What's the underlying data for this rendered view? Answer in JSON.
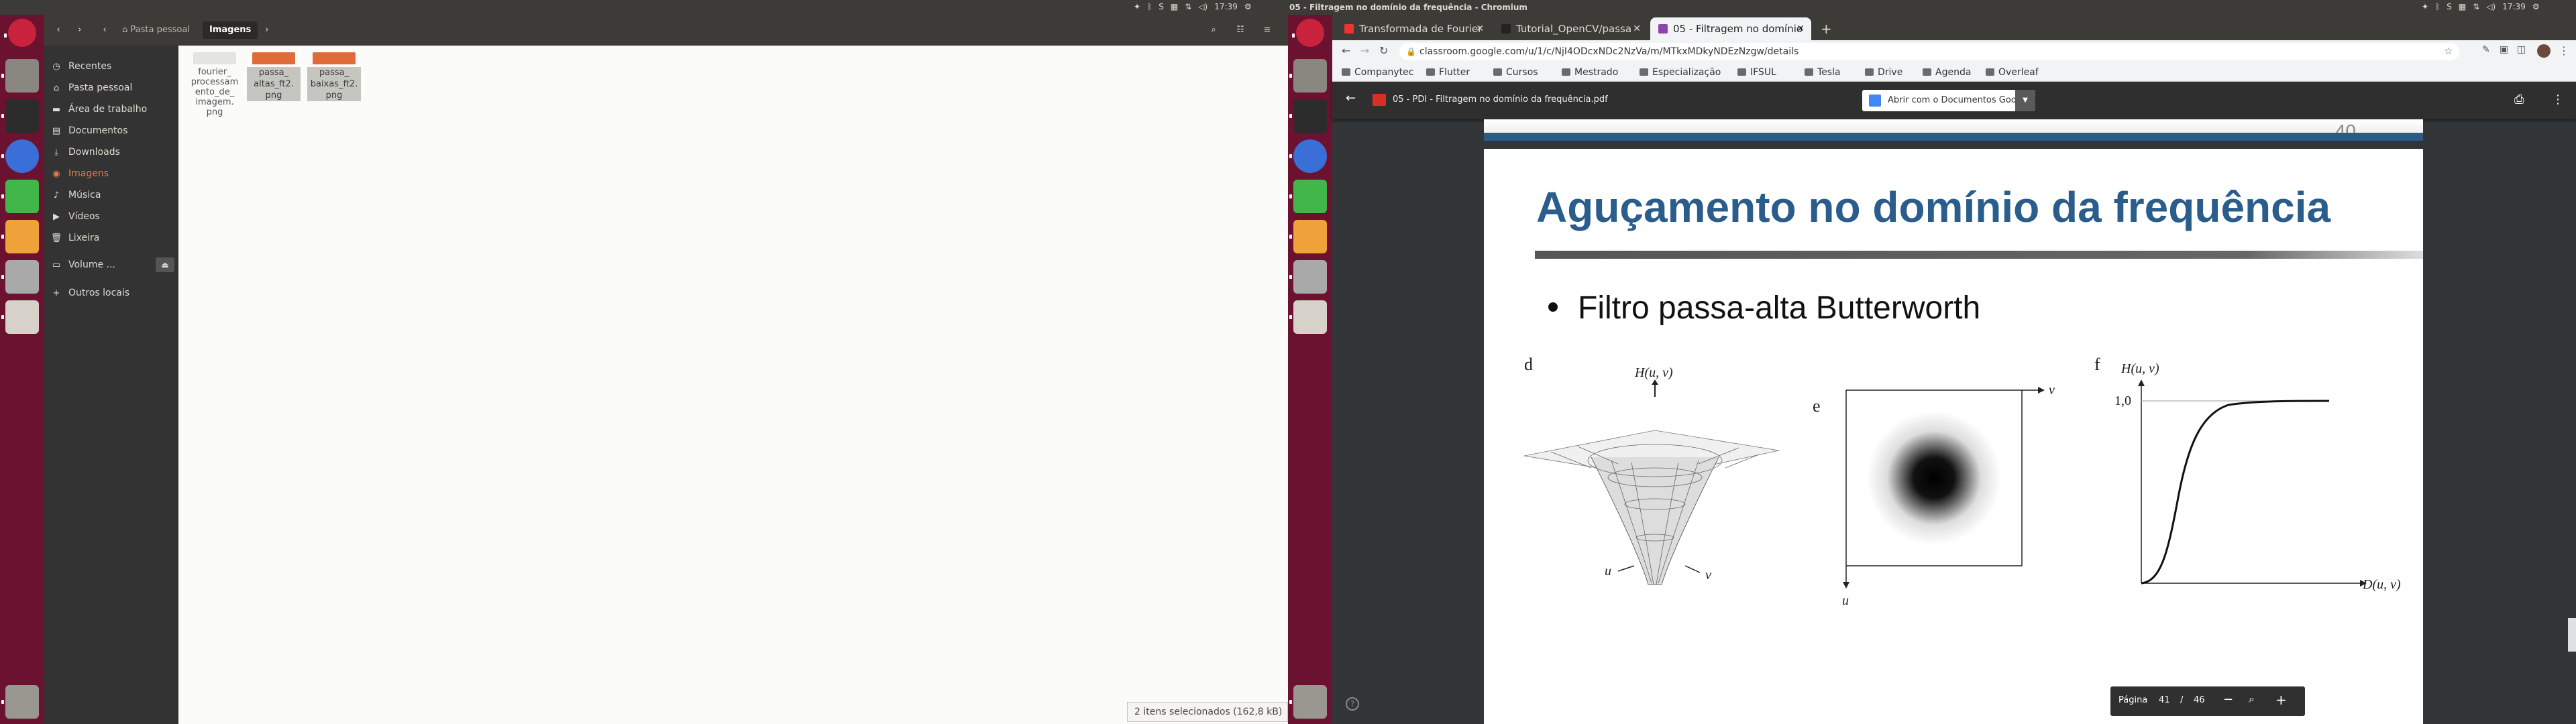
{
  "left_panel": {
    "time": "17:39",
    "tray_icons": [
      "dropbox-icon",
      "bluetooth-icon",
      "skype-icon",
      "keyboard-layout-icon",
      "wifi-icon",
      "volume-icon",
      "settings-icon"
    ]
  },
  "right_panel": {
    "window_title": "05 - Filtragem no domínio da frequência - Chromium",
    "time": "17:39"
  },
  "nautilus": {
    "breadcrumb_home": "Pasta pessoal",
    "breadcrumb_current": "Imagens",
    "sidebar": [
      {
        "label": "Recentes",
        "icon": "clock-icon",
        "glyph": "◷"
      },
      {
        "label": "Pasta pessoal",
        "icon": "home-icon",
        "glyph": "⌂"
      },
      {
        "label": "Área de trabalho",
        "icon": "folder-icon",
        "glyph": "▬"
      },
      {
        "label": "Documentos",
        "icon": "document-icon",
        "glyph": "▤"
      },
      {
        "label": "Downloads",
        "icon": "download-icon",
        "glyph": "⤓"
      },
      {
        "label": "Imagens",
        "icon": "camera-icon",
        "glyph": "◉"
      },
      {
        "label": "Música",
        "icon": "music-icon",
        "glyph": "♪"
      },
      {
        "label": "Vídeos",
        "icon": "video-icon",
        "glyph": "▶"
      },
      {
        "label": "Lixeira",
        "icon": "trash-icon",
        "glyph": "🗑"
      },
      {
        "label": "Volume ...",
        "icon": "drive-icon",
        "glyph": "▭"
      },
      {
        "label": "Outros locais",
        "icon": "plus-icon",
        "glyph": "+"
      }
    ],
    "files": [
      {
        "name": "fourier_processamento_de_imagem.png",
        "lines": [
          "fourier_",
          "processam",
          "ento_de_",
          "imagem.",
          "png"
        ],
        "selected": false,
        "thumb": "#e4e4e0"
      },
      {
        "name": "passa_altas_ft2.png",
        "lines": [
          "passa_",
          "altas_ft2.",
          "png"
        ],
        "selected": true,
        "thumb": "#e06a3a"
      },
      {
        "name": "passa_baixas_ft2.png",
        "lines": [
          "passa_",
          "baixas_ft2.",
          "png"
        ],
        "selected": true,
        "thumb": "#e06a3a"
      }
    ],
    "status": "2 itens selecionados (162,8 kB)"
  },
  "chromium": {
    "tabs": [
      {
        "label": "Transformada de Fourier",
        "active": false
      },
      {
        "label": "Tutorial_OpenCV/passa",
        "active": false
      },
      {
        "label": "05 - Filtragem no domínio",
        "active": true
      }
    ],
    "url": "classroom.google.com/u/1/c/NjI4ODcxNDc2NzVa/m/MTkxMDkyNDEzNzgw/details",
    "bookmarks": [
      "Companytec",
      "Flutter",
      "Cursos",
      "Mestrado",
      "Especialização",
      "IFSUL",
      "Tesla",
      "Drive",
      "Agenda",
      "Overleaf"
    ]
  },
  "viewer": {
    "doc_title": "05 - PDI - Filtragem no domínio da frequência.pdf",
    "open_with": "Abrir com o Documentos Google",
    "prev_page_number": "40",
    "slide_title": "Aguçamento no domínio da frequência",
    "bullet": "Filtro passa-alta Butterworth",
    "pager": {
      "label": "Página",
      "current": "41",
      "sep": "/",
      "total": "46"
    },
    "fig": {
      "d_label": "d",
      "e_label": "e",
      "f_label": "f",
      "d_axis_top": "H(u, v)",
      "d_axis_u": "u",
      "d_axis_v": "v",
      "e_axis_v": "v",
      "e_axis_u": "u",
      "f_axis_y": "H(u, v)",
      "f_ytick": "1,0",
      "f_axis_x": "D(u, v)"
    }
  }
}
